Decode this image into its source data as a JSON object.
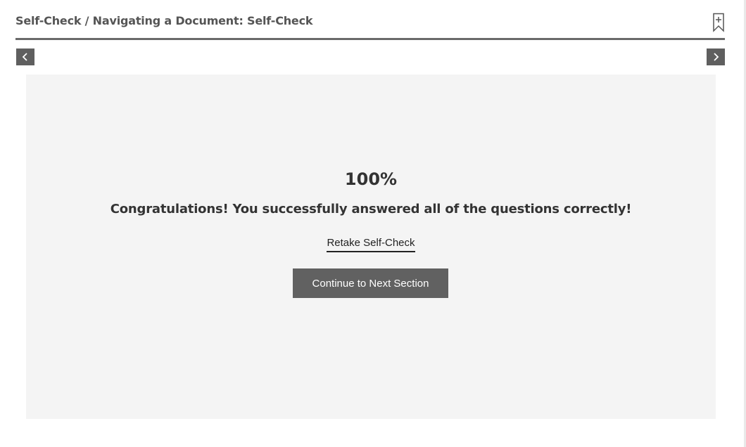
{
  "header": {
    "breadcrumb": "Self-Check / Navigating a Document: Self-Check",
    "bookmark_icon": "bookmark-add-icon"
  },
  "navigation": {
    "prev_icon": "chevron-left-icon",
    "next_icon": "chevron-right-icon"
  },
  "result": {
    "score": "100%",
    "progress_fraction": 1.0,
    "message": "Congratulations! You successfully answered all of the questions correctly!",
    "retake_label": "Retake Self-Check",
    "continue_label": "Continue to Next Section"
  },
  "colors": {
    "panel_background": "#f4f4f4",
    "button_background": "#616161",
    "rule": "#6a6a6a",
    "text": "#333333"
  }
}
